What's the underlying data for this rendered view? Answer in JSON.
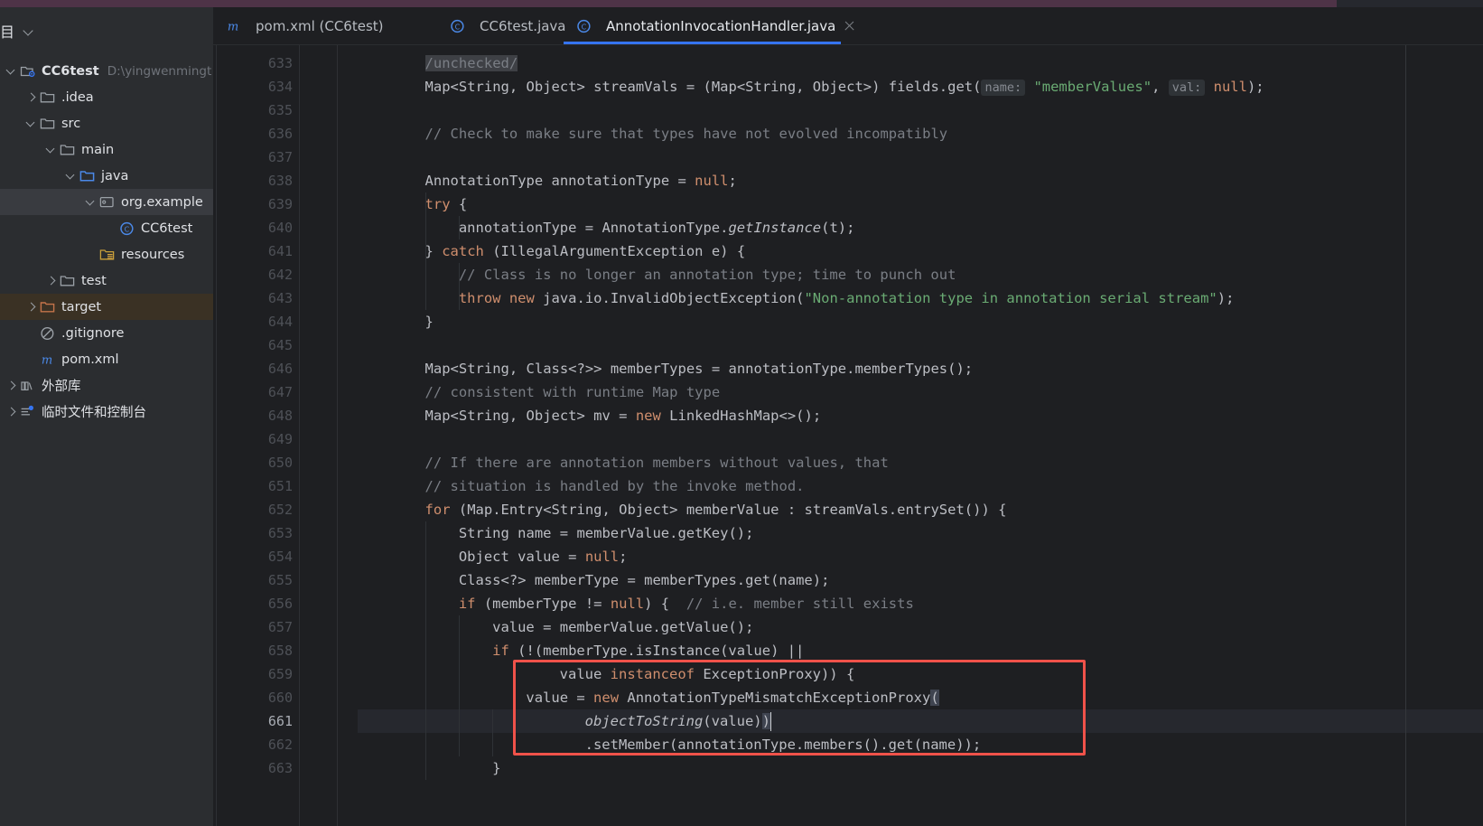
{
  "window": {
    "accent_bar_color": "#4e3347"
  },
  "project_panel": {
    "title": "项目",
    "dropdown_icon": "chevron-down-icon",
    "tree": [
      {
        "label": "CC6test",
        "path": "D:\\yingwenmingt",
        "icon": "module-icon",
        "arrow": "down",
        "indent": 0,
        "bold": true,
        "state": "normal"
      },
      {
        "label": ".idea",
        "path": "",
        "icon": "folder-icon",
        "arrow": "right",
        "indent": 1,
        "bold": false,
        "state": "normal"
      },
      {
        "label": "src",
        "path": "",
        "icon": "folder-icon",
        "arrow": "down",
        "indent": 1,
        "bold": false,
        "state": "normal"
      },
      {
        "label": "main",
        "path": "",
        "icon": "folder-icon",
        "arrow": "down",
        "indent": 2,
        "bold": false,
        "state": "normal"
      },
      {
        "label": "java",
        "path": "",
        "icon": "source-folder-icon",
        "arrow": "down",
        "indent": 3,
        "bold": false,
        "state": "normal"
      },
      {
        "label": "org.example",
        "path": "",
        "icon": "package-icon",
        "arrow": "down",
        "indent": 4,
        "bold": false,
        "state": "selected"
      },
      {
        "label": "CC6test",
        "path": "",
        "icon": "java-class-icon",
        "arrow": "none",
        "indent": 5,
        "bold": false,
        "state": "normal"
      },
      {
        "label": "resources",
        "path": "",
        "icon": "resources-folder-icon",
        "arrow": "none",
        "indent": 4,
        "bold": false,
        "state": "normal"
      },
      {
        "label": "test",
        "path": "",
        "icon": "folder-icon",
        "arrow": "right",
        "indent": 2,
        "bold": false,
        "state": "normal"
      },
      {
        "label": "target",
        "path": "",
        "icon": "target-folder-icon",
        "arrow": "right",
        "indent": 1,
        "bold": false,
        "state": "highlighted"
      },
      {
        "label": ".gitignore",
        "path": "",
        "icon": "gitignore-icon",
        "arrow": "none",
        "indent": 1,
        "bold": false,
        "state": "normal"
      },
      {
        "label": "pom.xml",
        "path": "",
        "icon": "maven-icon",
        "arrow": "none",
        "indent": 1,
        "bold": false,
        "state": "normal"
      },
      {
        "label": "外部库",
        "path": "",
        "icon": "external-libraries-icon",
        "arrow": "right",
        "indent": 0,
        "bold": false,
        "state": "normal"
      },
      {
        "label": "临时文件和控制台",
        "path": "",
        "icon": "scratches-icon",
        "arrow": "right",
        "indent": 0,
        "bold": false,
        "state": "normal"
      }
    ]
  },
  "editor": {
    "tabs": [
      {
        "label": "pom.xml (CC6test)",
        "icon": "maven-icon",
        "active": false,
        "closable": false
      },
      {
        "label": "CC6test.java",
        "icon": "java-class-icon",
        "active": false,
        "closable": false
      },
      {
        "label": "AnnotationInvocationHandler.java",
        "icon": "java-class-icon",
        "active": true,
        "closable": true
      }
    ],
    "active_tab_accent": "#3574f0",
    "close_icon": "close-icon",
    "current_line": 661,
    "first_line": 633,
    "annotation_box_color": "#f0524a",
    "lines": [
      {
        "n": 633,
        "indent": 8,
        "tokens": [
          {
            "t": "/unchecked/",
            "c": "anno-hl cmt"
          }
        ]
      },
      {
        "n": 634,
        "indent": 8,
        "tokens": [
          {
            "t": "Map<String, Object> streamVals = (Map<String, Object>) fields.get(",
            "c": "plain"
          },
          {
            "t": "name:",
            "c": "hint"
          },
          {
            "t": " ",
            "c": "plain"
          },
          {
            "t": "\"memberValues\"",
            "c": "str"
          },
          {
            "t": ", ",
            "c": "plain"
          },
          {
            "t": "val:",
            "c": "hint"
          },
          {
            "t": " ",
            "c": "plain"
          },
          {
            "t": "null",
            "c": "kw"
          },
          {
            "t": ");",
            "c": "plain"
          }
        ]
      },
      {
        "n": 635,
        "indent": 8,
        "tokens": []
      },
      {
        "n": 636,
        "indent": 8,
        "tokens": [
          {
            "t": "// Check to make sure that types have not evolved incompatibly",
            "c": "cmt"
          }
        ]
      },
      {
        "n": 637,
        "indent": 8,
        "tokens": []
      },
      {
        "n": 638,
        "indent": 8,
        "tokens": [
          {
            "t": "AnnotationType annotationType = ",
            "c": "plain"
          },
          {
            "t": "null",
            "c": "kw"
          },
          {
            "t": ";",
            "c": "plain"
          }
        ]
      },
      {
        "n": 639,
        "indent": 8,
        "tokens": [
          {
            "t": "try",
            "c": "kw"
          },
          {
            "t": " {",
            "c": "plain"
          }
        ]
      },
      {
        "n": 640,
        "indent": 12,
        "tokens": [
          {
            "t": "annotationType = AnnotationType.",
            "c": "plain"
          },
          {
            "t": "getInstance",
            "c": "mth"
          },
          {
            "t": "(t);",
            "c": "plain"
          }
        ]
      },
      {
        "n": 641,
        "indent": 8,
        "tokens": [
          {
            "t": "} ",
            "c": "plain"
          },
          {
            "t": "catch",
            "c": "kw"
          },
          {
            "t": " (IllegalArgumentException e) {",
            "c": "plain"
          }
        ]
      },
      {
        "n": 642,
        "indent": 12,
        "tokens": [
          {
            "t": "// Class is no longer an annotation type; time to punch out",
            "c": "cmt"
          }
        ]
      },
      {
        "n": 643,
        "indent": 12,
        "tokens": [
          {
            "t": "throw",
            "c": "kw"
          },
          {
            "t": " ",
            "c": "plain"
          },
          {
            "t": "new",
            "c": "kw"
          },
          {
            "t": " java.io.InvalidObjectException(",
            "c": "plain"
          },
          {
            "t": "\"Non-annotation type in annotation serial stream\"",
            "c": "str"
          },
          {
            "t": ");",
            "c": "plain"
          }
        ]
      },
      {
        "n": 644,
        "indent": 8,
        "tokens": [
          {
            "t": "}",
            "c": "plain"
          }
        ]
      },
      {
        "n": 645,
        "indent": 8,
        "tokens": []
      },
      {
        "n": 646,
        "indent": 8,
        "tokens": [
          {
            "t": "Map<String, Class<?>> memberTypes = annotationType.memberTypes();",
            "c": "plain"
          }
        ]
      },
      {
        "n": 647,
        "indent": 8,
        "tokens": [
          {
            "t": "// consistent with runtime Map type",
            "c": "cmt"
          }
        ]
      },
      {
        "n": 648,
        "indent": 8,
        "tokens": [
          {
            "t": "Map<String, Object> mv = ",
            "c": "plain"
          },
          {
            "t": "new",
            "c": "kw"
          },
          {
            "t": " LinkedHashMap<>();",
            "c": "plain"
          }
        ]
      },
      {
        "n": 649,
        "indent": 8,
        "tokens": []
      },
      {
        "n": 650,
        "indent": 8,
        "tokens": [
          {
            "t": "// If there are annotation members without values, that",
            "c": "cmt"
          }
        ]
      },
      {
        "n": 651,
        "indent": 8,
        "tokens": [
          {
            "t": "// situation is handled by the invoke method.",
            "c": "cmt"
          }
        ]
      },
      {
        "n": 652,
        "indent": 8,
        "tokens": [
          {
            "t": "for",
            "c": "kw"
          },
          {
            "t": " (Map.Entry<String, Object> memberValue : streamVals.entrySet()) {",
            "c": "plain"
          }
        ]
      },
      {
        "n": 653,
        "indent": 12,
        "tokens": [
          {
            "t": "String name = memberValue.getKey();",
            "c": "plain"
          }
        ]
      },
      {
        "n": 654,
        "indent": 12,
        "tokens": [
          {
            "t": "Object value = ",
            "c": "plain"
          },
          {
            "t": "null",
            "c": "kw"
          },
          {
            "t": ";",
            "c": "plain"
          }
        ]
      },
      {
        "n": 655,
        "indent": 12,
        "tokens": [
          {
            "t": "Class<?> memberType = memberTypes.get(name);",
            "c": "plain"
          }
        ]
      },
      {
        "n": 656,
        "indent": 12,
        "tokens": [
          {
            "t": "if",
            "c": "kw"
          },
          {
            "t": " (memberType != ",
            "c": "plain"
          },
          {
            "t": "null",
            "c": "kw"
          },
          {
            "t": ") {  ",
            "c": "plain"
          },
          {
            "t": "// i.e. member still exists",
            "c": "cmt"
          }
        ]
      },
      {
        "n": 657,
        "indent": 16,
        "tokens": [
          {
            "t": "value = memberValue.getValue();",
            "c": "plain"
          }
        ]
      },
      {
        "n": 658,
        "indent": 16,
        "tokens": [
          {
            "t": "if",
            "c": "kw"
          },
          {
            "t": " (!(memberType.isInstance(value) ||",
            "c": "plain"
          }
        ]
      },
      {
        "n": 659,
        "indent": 24,
        "tokens": [
          {
            "t": "value ",
            "c": "plain"
          },
          {
            "t": "instanceof",
            "c": "kw"
          },
          {
            "t": " ExceptionProxy)) {",
            "c": "plain"
          }
        ]
      },
      {
        "n": 660,
        "indent": 20,
        "tokens": [
          {
            "t": "value = ",
            "c": "plain"
          },
          {
            "t": "new",
            "c": "kw"
          },
          {
            "t": " AnnotationTypeMismatchExceptionProxy",
            "c": "plain"
          },
          {
            "t": "(",
            "c": "brace-hl"
          }
        ]
      },
      {
        "n": 661,
        "indent": 27,
        "tokens": [
          {
            "t": "objectToString",
            "c": "mth"
          },
          {
            "t": "(value)",
            "c": "plain"
          },
          {
            "t": ")",
            "c": "brace-hl"
          }
        ]
      },
      {
        "n": 662,
        "indent": 27,
        "tokens": [
          {
            "t": ".setMember(annotationType.members().get(name));",
            "c": "plain"
          }
        ]
      },
      {
        "n": 663,
        "indent": 16,
        "tokens": [
          {
            "t": "}",
            "c": "plain"
          }
        ]
      }
    ]
  }
}
